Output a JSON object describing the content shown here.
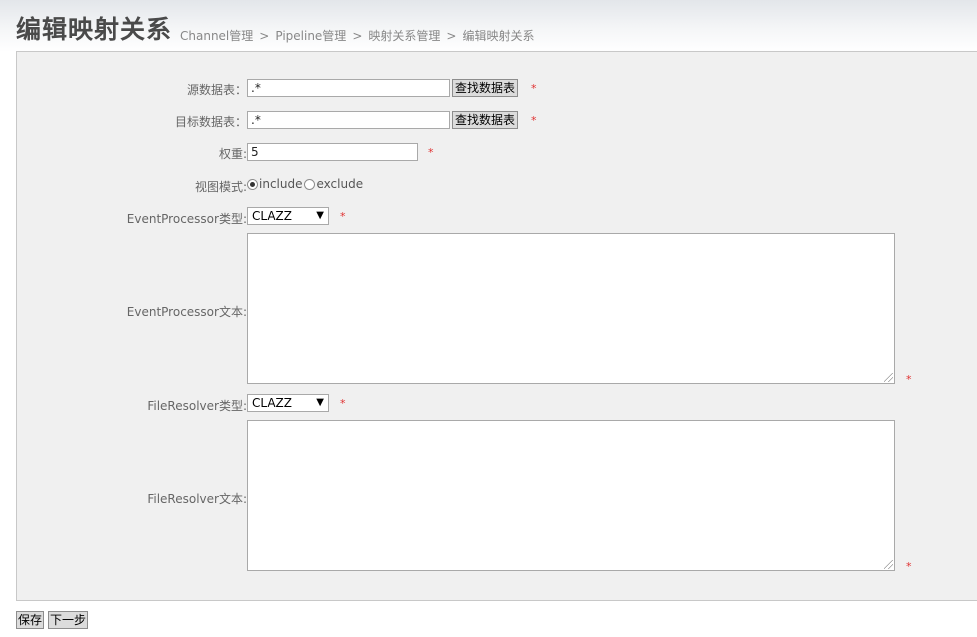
{
  "header": {
    "title": "编辑映射关系",
    "breadcrumb": [
      "Channel管理",
      "Pipeline管理",
      "映射关系管理",
      "编辑映射关系"
    ],
    "separator": ">"
  },
  "form": {
    "source_table": {
      "label": "源数据表：",
      "value": ".*",
      "button": "查找数据表"
    },
    "target_table": {
      "label": "目标数据表：",
      "value": ".*",
      "button": "查找数据表"
    },
    "weight": {
      "label": "权重:",
      "value": "5"
    },
    "view_mode": {
      "label": "视图模式:",
      "options": [
        "include",
        "exclude"
      ],
      "selected": "include"
    },
    "event_processor_type": {
      "label": "EventProcessor类型:",
      "value": "CLAZZ"
    },
    "event_processor_text": {
      "label": "EventProcessor文本:",
      "value": ""
    },
    "file_resolver_type": {
      "label": "FileResolver类型:",
      "value": "CLAZZ"
    },
    "file_resolver_text": {
      "label": "FileResolver文本:",
      "value": ""
    },
    "required_mark": "*"
  },
  "actions": {
    "save": "保存",
    "next": "下一步"
  },
  "colors": {
    "required": "#e03030",
    "panel": "#f0f0f0"
  }
}
